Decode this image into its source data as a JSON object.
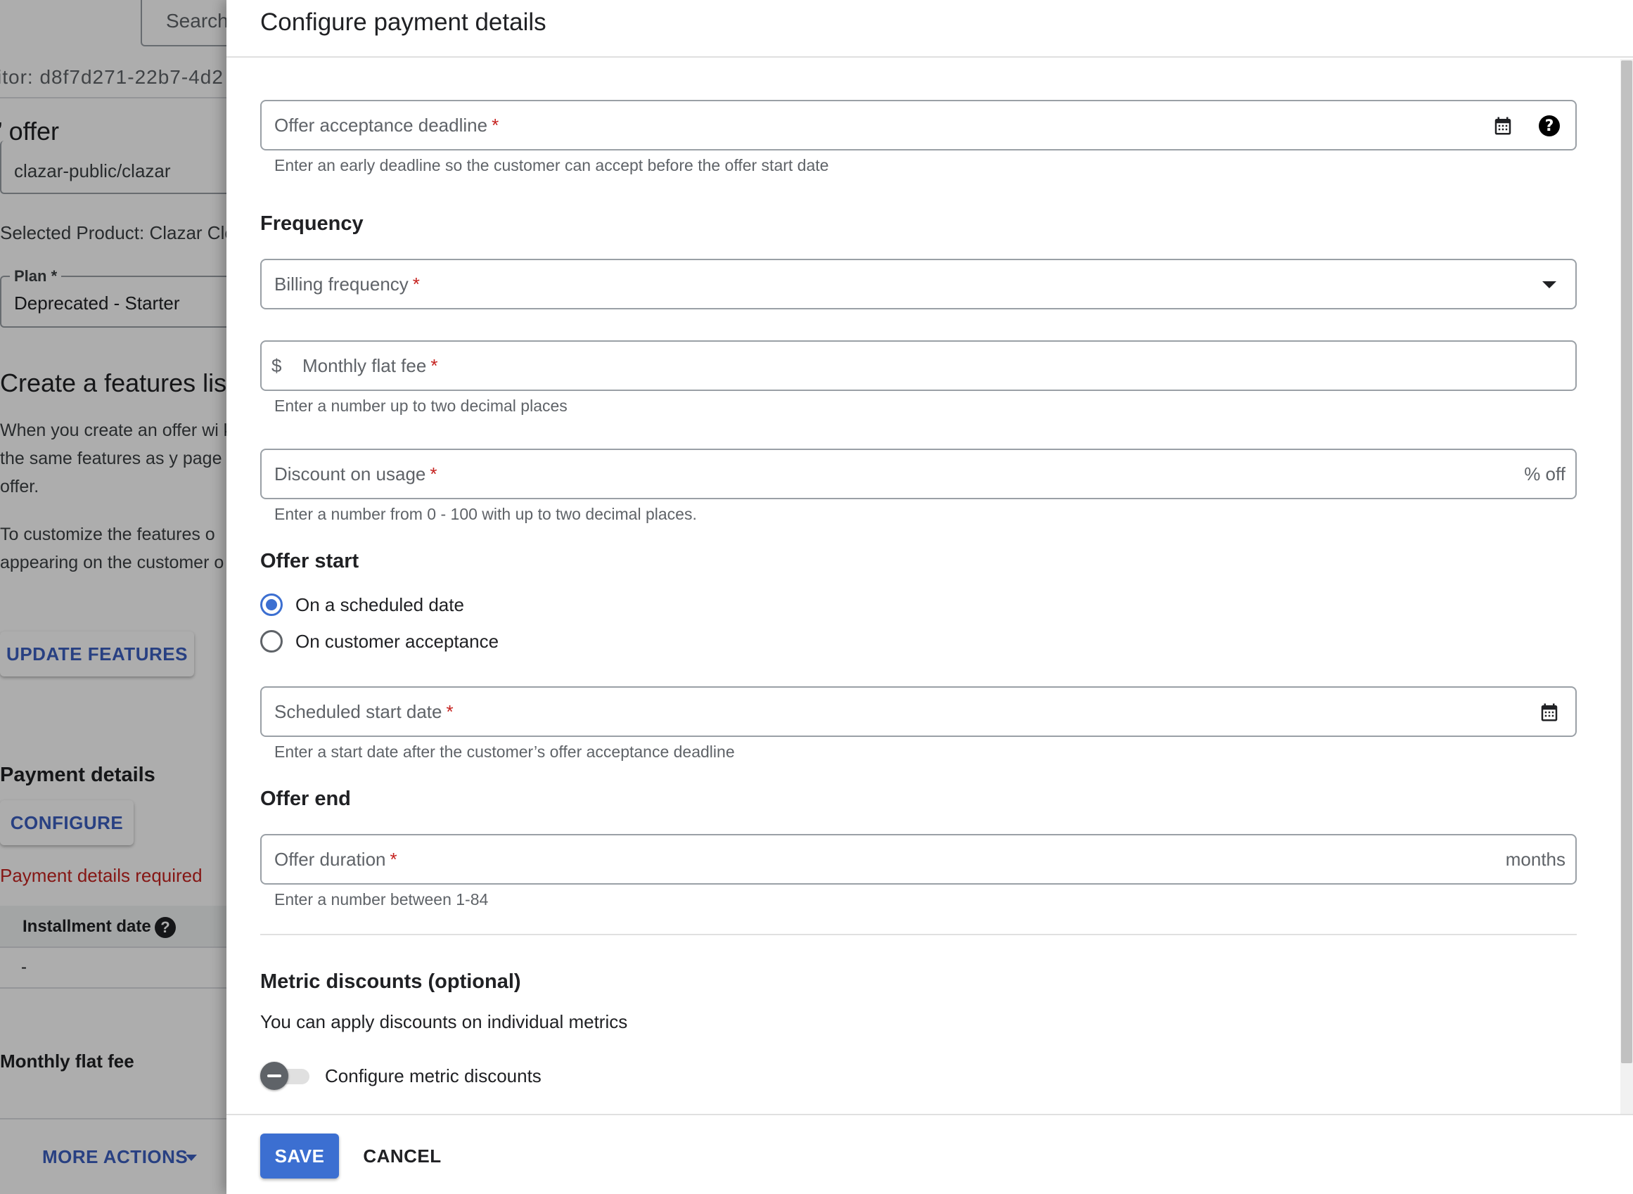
{
  "background": {
    "search_placeholder": "Search",
    "visitor_id": "itor:  d8f7d271-22b7-4d2",
    "offer_title": "’ offer",
    "repo_value": "clazar-public/clazar",
    "selected_product": "Selected Product: Clazar Clo",
    "plan_label": "Plan *",
    "plan_value": "Deprecated - Starter",
    "features_title": "Create a features list",
    "features_p1": "When you create an offer wi keep the same features as y page for the offer.",
    "features_p2": "To customize the features o appearing on the customer o",
    "update_features_button": "UPDATE FEATURES",
    "payment_details_title": "Payment details",
    "configure_button": "CONFIGURE",
    "payment_required": "Payment details required",
    "installment_date_label": "Installment date",
    "installment_help": "?",
    "installment_value": "-",
    "monthly_flat_fee_label": "Monthly flat fee",
    "more_actions_button": "MORE ACTIONS"
  },
  "dialog": {
    "title": "Configure payment details",
    "acceptance_deadline": {
      "label": "Offer acceptance deadline",
      "required": "*",
      "hint": "Enter an early deadline so the customer can accept before the offer start date",
      "help": "?"
    },
    "frequency": {
      "section_title": "Frequency",
      "billing_label": "Billing frequency",
      "required": "*"
    },
    "monthly_fee": {
      "prefix": "$",
      "label": "Monthly flat fee",
      "required": "*",
      "hint": "Enter a number up to two decimal places"
    },
    "discount": {
      "label": "Discount on usage",
      "required": "*",
      "suffix": "% off",
      "hint": "Enter a number from 0 - 100 with up to two decimal places."
    },
    "offer_start": {
      "section_title": "Offer start",
      "options": [
        "On a scheduled date",
        "On customer acceptance"
      ],
      "selected": "On a scheduled date",
      "start_date_label": "Scheduled start date",
      "required": "*",
      "start_date_hint": "Enter a start date after the customer’s offer acceptance deadline"
    },
    "offer_end": {
      "section_title": "Offer end",
      "duration_label": "Offer duration",
      "required": "*",
      "suffix": "months",
      "hint": "Enter a number between 1-84"
    },
    "metric_discounts": {
      "section_title": "Metric discounts (optional)",
      "description": "You can apply discounts on individual metrics",
      "toggle_label": "Configure metric discounts",
      "toggle_on": false
    },
    "save_button": "SAVE",
    "cancel_button": "CANCEL"
  },
  "colors": {
    "primary": "#3c6fd1",
    "error": "#c5221f",
    "link": "#3b5fc0"
  }
}
